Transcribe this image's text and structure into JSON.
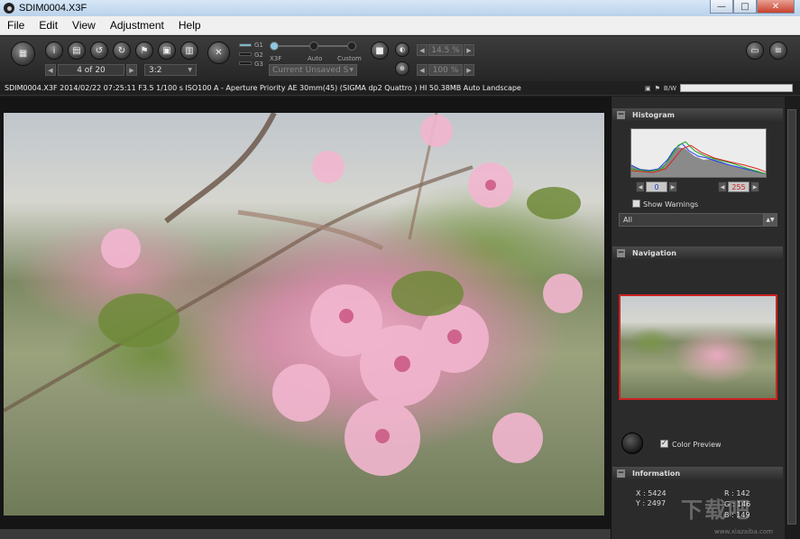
{
  "window": {
    "title": "SDIM0004.X3F",
    "minimize": "—",
    "maximize": "□",
    "close": "✕"
  },
  "menu": [
    "File",
    "Edit",
    "View",
    "Adjustment",
    "Help"
  ],
  "toolbar": {
    "page_indicator": "4 of 20",
    "aspect": "3:2",
    "g_labels": [
      "G1",
      "G2",
      "G3"
    ],
    "mode_labels": [
      "X3F",
      "Auto",
      "Custom"
    ],
    "preset": "Current Unsaved S",
    "exposure": "14.5 %",
    "zoom": "100 %"
  },
  "info_line": "SDIM0004.X3F 2014/02/22 07:25:11 F3.5 1/100 s ISO100 A - Aperture Priority AE 30mm(45) (SIGMA dp2 Quattro ) HI 50.38MB Auto Landscape",
  "bw_label": "B/W",
  "histogram": {
    "title": "Histogram",
    "low_value": "0",
    "high_value": "255",
    "show_warnings": "Show Warnings",
    "channel": "All"
  },
  "navigation": {
    "title": "Navigation",
    "color_preview": "Color Preview"
  },
  "information": {
    "title": "Information",
    "x": "X : 5424",
    "y": "Y : 2497",
    "r": "R : 142",
    "g": "G : 146",
    "b": "B : 149"
  },
  "watermark": {
    "logo": "下载吧",
    "url": "www.xiazaiba.com"
  },
  "colors": {
    "accent_slider": "#8cc8e0",
    "nav_border": "#cc2222",
    "high_value_text": "#cc2222",
    "low_value_text": "#2244cc"
  }
}
